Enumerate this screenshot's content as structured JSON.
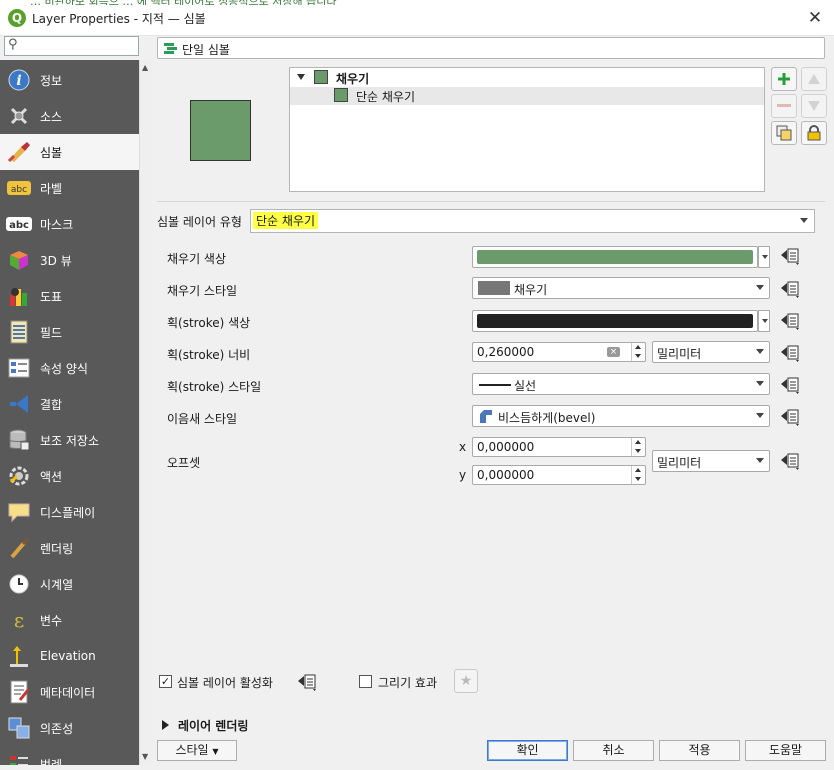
{
  "window": {
    "title": "Layer Properties - 지적 — 심볼",
    "bg_text": "… 비관하보 회득으 … 에 벡터 레이어로 성공적으로 저장해 습니다"
  },
  "sidebar": {
    "search_placeholder": "",
    "items": [
      {
        "label": "정보",
        "icon": "info-icon"
      },
      {
        "label": "소스",
        "icon": "source-icon"
      },
      {
        "label": "심볼",
        "icon": "symbology-icon",
        "active": true
      },
      {
        "label": "라벨",
        "icon": "labels-icon"
      },
      {
        "label": "마스크",
        "icon": "mask-icon"
      },
      {
        "label": "3D 뷰",
        "icon": "3d-icon"
      },
      {
        "label": "도표",
        "icon": "diagram-icon"
      },
      {
        "label": "필드",
        "icon": "fields-icon"
      },
      {
        "label": "속성 양식",
        "icon": "attribute-form-icon"
      },
      {
        "label": "결합",
        "icon": "joins-icon"
      },
      {
        "label": "보조 저장소",
        "icon": "auxiliary-storage-icon"
      },
      {
        "label": "액션",
        "icon": "actions-icon"
      },
      {
        "label": "디스플레이",
        "icon": "display-icon"
      },
      {
        "label": "렌더링",
        "icon": "rendering-icon"
      },
      {
        "label": "시계열",
        "icon": "temporal-icon"
      },
      {
        "label": "변수",
        "icon": "variables-icon"
      },
      {
        "label": "Elevation",
        "icon": "elevation-icon"
      },
      {
        "label": "메타데이터",
        "icon": "metadata-icon"
      },
      {
        "label": "의존성",
        "icon": "dependencies-icon"
      },
      {
        "label": "범례",
        "icon": "legend-icon"
      }
    ]
  },
  "renderer": {
    "label": "단일 심볼"
  },
  "symbol": {
    "fill_color": "#6b9a6b",
    "tree": {
      "root": "채우기",
      "child": "단순 채우기"
    }
  },
  "layer_type": {
    "label": "심볼 레이어 유형",
    "value": "단순 채우기"
  },
  "form": {
    "fill_color": {
      "label": "채우기 색상",
      "color": "#6b9a6b"
    },
    "fill_style": {
      "label": "채우기 스타일",
      "value": "채우기"
    },
    "stroke_color": {
      "label": "획(stroke) 색상",
      "color": "#222222"
    },
    "stroke_width": {
      "label": "획(stroke) 너비",
      "value": "0,260000",
      "unit": "밀리미터"
    },
    "stroke_style": {
      "label": "획(stroke) 스타일",
      "value": "실선"
    },
    "join_style": {
      "label": "이음새 스타일",
      "value": "비스듬하게(bevel)"
    },
    "offset": {
      "label": "오프셋",
      "x_label": "x",
      "y_label": "y",
      "x": "0,000000",
      "y": "0,000000",
      "unit": "밀리미터"
    }
  },
  "footer": {
    "enable_layer": {
      "label": "심볼 레이어 활성화",
      "checked": true
    },
    "draw_effects": {
      "label": "그리기 효과",
      "checked": false
    },
    "layer_rendering": "레이어 렌더링"
  },
  "buttons": {
    "style": "스타일",
    "ok": "확인",
    "cancel": "취소",
    "apply": "적용",
    "help": "도움말"
  }
}
